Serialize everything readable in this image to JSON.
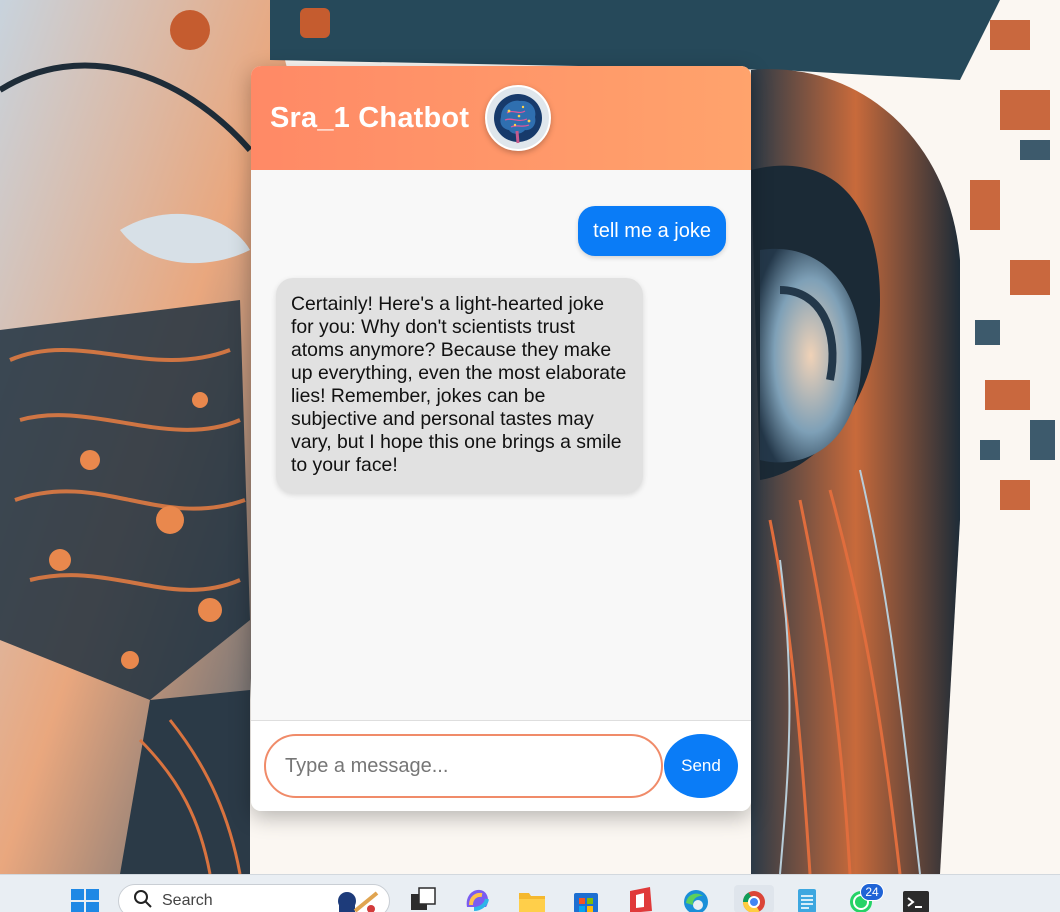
{
  "chat": {
    "title": "Sra_1 Chatbot",
    "avatar_icon": "brain-icon",
    "messages": [
      {
        "role": "user",
        "text": "tell me a joke"
      },
      {
        "role": "bot",
        "text": "Certainly! Here's a light-hearted joke for you: Why don't scientists trust atoms anymore? Because they make up everything, even the most elaborate lies! Remember, jokes can be subjective and personal tastes may vary, but I hope this one brings a smile to your face!"
      }
    ],
    "input": {
      "value": "",
      "placeholder": "Type a message..."
    },
    "send_label": "Send",
    "colors": {
      "header_start": "#ff8966",
      "header_end": "#ffa36c",
      "user_bubble": "#0a7cf7",
      "bot_bubble": "#e1e1e1",
      "accent": "#f08b69"
    }
  },
  "taskbar": {
    "search_label": "Search",
    "icons": [
      "windows-start-icon",
      "search-icon",
      "task-view-icon",
      "copilot-icon",
      "file-explorer-icon",
      "store-icon",
      "office-icon",
      "edge-icon",
      "chrome-icon",
      "notepad-icon",
      "whatsapp-icon",
      "terminal-icon"
    ],
    "whatsapp_badge": "24"
  }
}
